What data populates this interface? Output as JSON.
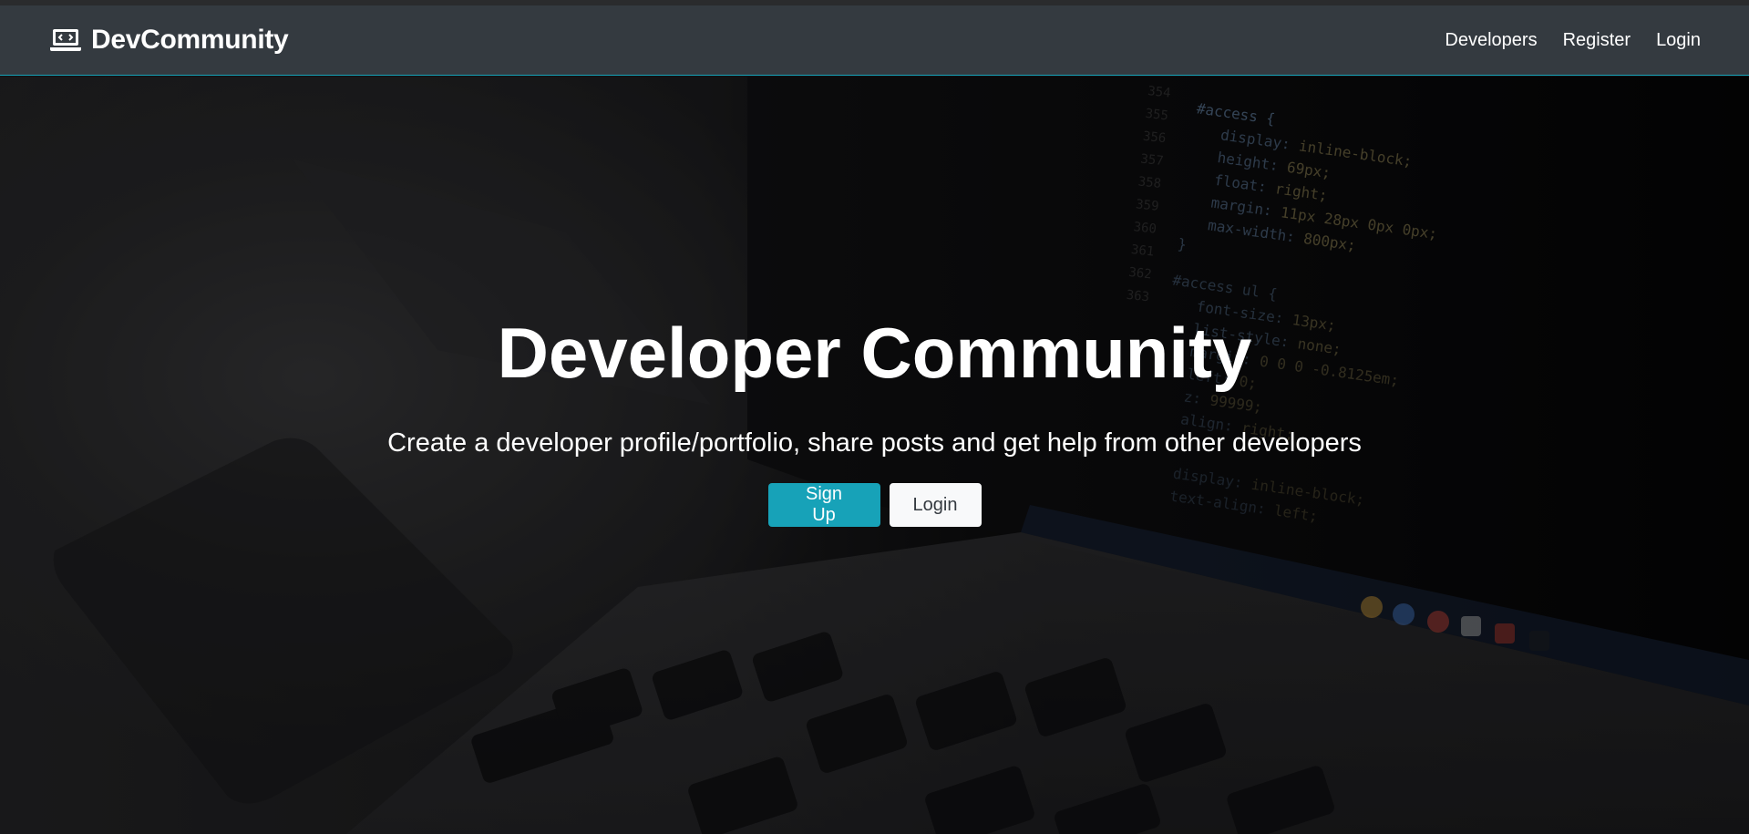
{
  "navbar": {
    "brand": {
      "icon": "laptop-code-icon",
      "text": "DevCommunity"
    },
    "links": [
      {
        "label": "Developers"
      },
      {
        "label": "Register"
      },
      {
        "label": "Login"
      }
    ]
  },
  "hero": {
    "title": "Developer Community",
    "lead": "Create a developer profile/portfolio, share posts and get help from other developers",
    "buttons": {
      "signup": "Sign Up",
      "login": "Login"
    }
  },
  "colors": {
    "navbar_bg": "#343a40",
    "accent": "#17a2b8",
    "light_button": "#f8f9fa"
  }
}
